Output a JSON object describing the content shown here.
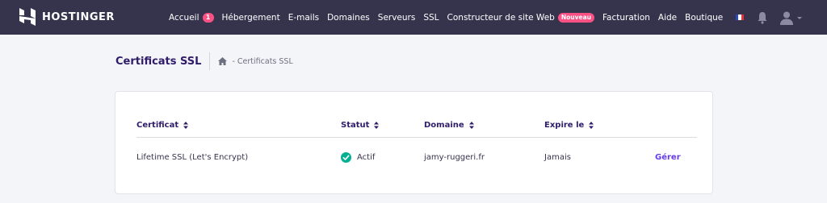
{
  "brand": {
    "name": "HOSTINGER"
  },
  "nav": {
    "items": [
      {
        "label": "Accueil",
        "badge": "1"
      },
      {
        "label": "Hébergement"
      },
      {
        "label": "E-mails"
      },
      {
        "label": "Domaines"
      },
      {
        "label": "Serveurs"
      },
      {
        "label": "SSL"
      },
      {
        "label": "Constructeur de site Web",
        "badge_new": "Nouveau"
      },
      {
        "label": "Facturation"
      },
      {
        "label": "Aide"
      },
      {
        "label": "Boutique"
      }
    ]
  },
  "header": {
    "title": "Certificats SSL",
    "breadcrumb": "- Certificats SSL"
  },
  "table": {
    "columns": [
      "Certificat",
      "Statut",
      "Domaine",
      "Expire le"
    ],
    "rows": [
      {
        "certificate": "Lifetime SSL (Let's Encrypt)",
        "status": "Actif",
        "domain": "jamy-ruggeri.fr",
        "expires": "Jamais",
        "action": "Gérer"
      }
    ]
  },
  "colors": {
    "topbar": "#36344d",
    "accent": "#673de6",
    "badge": "#fc5185",
    "success": "#00b090"
  },
  "icons": {
    "logo": "hostinger-logo-icon",
    "flag": "flag-fr-icon",
    "bell": "bell-icon",
    "user": "user-icon",
    "home": "home-icon",
    "sort": "sort-icon",
    "status": "check-circle-icon"
  }
}
